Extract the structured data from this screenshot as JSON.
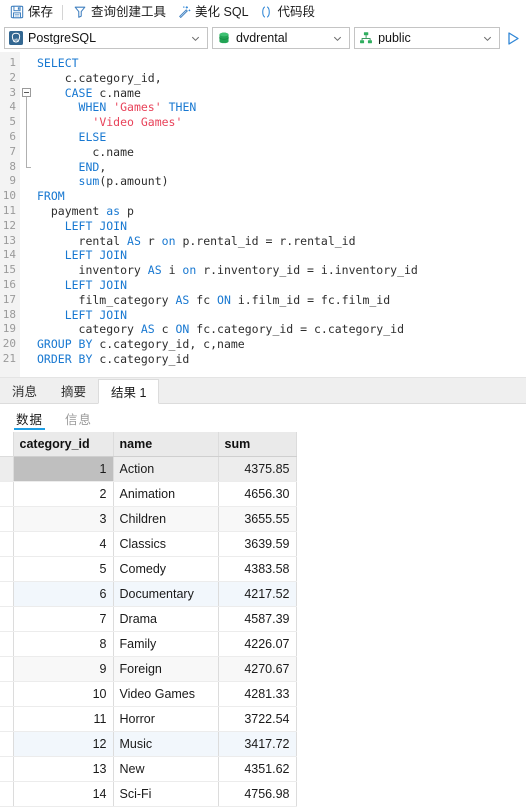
{
  "toolbar": {
    "items": [
      {
        "label": "保存",
        "icon": "save-icon",
        "name": "save"
      },
      {
        "label": "查询创建工具",
        "icon": "query-builder-icon",
        "name": "query-builder"
      },
      {
        "label": "美化 SQL",
        "icon": "beautify-icon",
        "name": "beautify-sql"
      },
      {
        "label": "代码段",
        "icon": "snippet-icon",
        "name": "snippet"
      }
    ]
  },
  "connection": {
    "driver": {
      "label": "PostgreSQL",
      "icon": "postgresql-icon"
    },
    "database": {
      "label": "dvdrental",
      "icon": "database-icon"
    },
    "schema": {
      "label": "public",
      "icon": "schema-icon"
    },
    "run": {
      "icon": "run-icon",
      "label": ""
    }
  },
  "editor": {
    "lines": [
      {
        "n": "1",
        "tokens": [
          {
            "t": "SELECT",
            "c": "kw"
          }
        ]
      },
      {
        "n": "2",
        "tokens": [
          {
            "t": "    c.category_id,",
            "c": "id"
          }
        ]
      },
      {
        "n": "3",
        "fold": "start",
        "tokens": [
          {
            "t": "    ",
            "c": "id"
          },
          {
            "t": "CASE",
            "c": "kw"
          },
          {
            "t": " c.name",
            "c": "id"
          }
        ]
      },
      {
        "n": "4",
        "fold": "cont",
        "tokens": [
          {
            "t": "      ",
            "c": "id"
          },
          {
            "t": "WHEN",
            "c": "kw"
          },
          {
            "t": " ",
            "c": "id"
          },
          {
            "t": "'Games'",
            "c": "str"
          },
          {
            "t": " ",
            "c": "id"
          },
          {
            "t": "THEN",
            "c": "kw"
          }
        ]
      },
      {
        "n": "5",
        "fold": "cont",
        "tokens": [
          {
            "t": "        ",
            "c": "id"
          },
          {
            "t": "'Video Games'",
            "c": "str"
          }
        ]
      },
      {
        "n": "6",
        "fold": "cont",
        "tokens": [
          {
            "t": "      ",
            "c": "id"
          },
          {
            "t": "ELSE",
            "c": "kw"
          }
        ]
      },
      {
        "n": "7",
        "fold": "cont",
        "tokens": [
          {
            "t": "        c.name",
            "c": "id"
          }
        ]
      },
      {
        "n": "8",
        "fold": "end",
        "tokens": [
          {
            "t": "      ",
            "c": "id"
          },
          {
            "t": "END",
            "c": "kw"
          },
          {
            "t": ",",
            "c": "id"
          }
        ]
      },
      {
        "n": "9",
        "tokens": [
          {
            "t": "      ",
            "c": "id"
          },
          {
            "t": "sum",
            "c": "fn"
          },
          {
            "t": "(p.amount)",
            "c": "id"
          }
        ]
      },
      {
        "n": "10",
        "tokens": [
          {
            "t": "FROM",
            "c": "kw"
          }
        ]
      },
      {
        "n": "11",
        "tokens": [
          {
            "t": "  payment ",
            "c": "id"
          },
          {
            "t": "as",
            "c": "kw"
          },
          {
            "t": " p",
            "c": "id"
          }
        ]
      },
      {
        "n": "12",
        "tokens": [
          {
            "t": "    ",
            "c": "id"
          },
          {
            "t": "LEFT JOIN",
            "c": "kw"
          }
        ]
      },
      {
        "n": "13",
        "tokens": [
          {
            "t": "      rental ",
            "c": "id"
          },
          {
            "t": "AS",
            "c": "kw"
          },
          {
            "t": " r ",
            "c": "id"
          },
          {
            "t": "on",
            "c": "kw"
          },
          {
            "t": " p.rental_id = r.rental_id",
            "c": "id"
          }
        ]
      },
      {
        "n": "14",
        "tokens": [
          {
            "t": "    ",
            "c": "id"
          },
          {
            "t": "LEFT JOIN",
            "c": "kw"
          }
        ]
      },
      {
        "n": "15",
        "tokens": [
          {
            "t": "      inventory ",
            "c": "id"
          },
          {
            "t": "AS",
            "c": "kw"
          },
          {
            "t": " i ",
            "c": "id"
          },
          {
            "t": "on",
            "c": "kw"
          },
          {
            "t": " r.inventory_id = i.inventory_id",
            "c": "id"
          }
        ]
      },
      {
        "n": "16",
        "tokens": [
          {
            "t": "    ",
            "c": "id"
          },
          {
            "t": "LEFT JOIN",
            "c": "kw"
          }
        ]
      },
      {
        "n": "17",
        "tokens": [
          {
            "t": "      film_category ",
            "c": "id"
          },
          {
            "t": "AS",
            "c": "kw"
          },
          {
            "t": " fc ",
            "c": "id"
          },
          {
            "t": "ON",
            "c": "kw"
          },
          {
            "t": " i.film_id = fc.film_id",
            "c": "id"
          }
        ]
      },
      {
        "n": "18",
        "tokens": [
          {
            "t": "    ",
            "c": "id"
          },
          {
            "t": "LEFT JOIN",
            "c": "kw"
          }
        ]
      },
      {
        "n": "19",
        "tokens": [
          {
            "t": "      category ",
            "c": "id"
          },
          {
            "t": "AS",
            "c": "kw"
          },
          {
            "t": " c ",
            "c": "id"
          },
          {
            "t": "ON",
            "c": "kw"
          },
          {
            "t": " fc.category_id = c.category_id",
            "c": "id"
          }
        ]
      },
      {
        "n": "20",
        "tokens": [
          {
            "t": "GROUP BY",
            "c": "kw"
          },
          {
            "t": " c.category_id, c,name",
            "c": "id"
          }
        ]
      },
      {
        "n": "21",
        "tokens": [
          {
            "t": "ORDER BY",
            "c": "kw"
          },
          {
            "t": " c.category_id",
            "c": "id"
          }
        ]
      }
    ]
  },
  "result_tabs": [
    {
      "label": "消息",
      "active": false
    },
    {
      "label": "摘要",
      "active": false
    },
    {
      "label": "结果 1",
      "active": true
    }
  ],
  "sub_tabs": [
    {
      "label": "数据",
      "active": true
    },
    {
      "label": "信息",
      "active": false
    }
  ],
  "grid": {
    "columns": [
      "category_id",
      "name",
      "sum"
    ],
    "rows": [
      {
        "category_id": "1",
        "name": "Action",
        "sum": "4375.85",
        "state": "selected"
      },
      {
        "category_id": "2",
        "name": "Animation",
        "sum": "4656.30",
        "state": "normal"
      },
      {
        "category_id": "3",
        "name": "Children",
        "sum": "3655.55",
        "state": "alt"
      },
      {
        "category_id": "4",
        "name": "Classics",
        "sum": "3639.59",
        "state": "normal"
      },
      {
        "category_id": "5",
        "name": "Comedy",
        "sum": "4383.58",
        "state": "normal"
      },
      {
        "category_id": "6",
        "name": "Documentary",
        "sum": "4217.52",
        "state": "blue"
      },
      {
        "category_id": "7",
        "name": "Drama",
        "sum": "4587.39",
        "state": "normal"
      },
      {
        "category_id": "8",
        "name": "Family",
        "sum": "4226.07",
        "state": "normal"
      },
      {
        "category_id": "9",
        "name": "Foreign",
        "sum": "4270.67",
        "state": "alt"
      },
      {
        "category_id": "10",
        "name": "Video Games",
        "sum": "4281.33",
        "state": "normal"
      },
      {
        "category_id": "11",
        "name": "Horror",
        "sum": "3722.54",
        "state": "normal"
      },
      {
        "category_id": "12",
        "name": "Music",
        "sum": "3417.72",
        "state": "blue"
      },
      {
        "category_id": "13",
        "name": "New",
        "sum": "4351.62",
        "state": "normal"
      },
      {
        "category_id": "14",
        "name": "Sci-Fi",
        "sum": "4756.98",
        "state": "normal"
      }
    ]
  },
  "colors": {
    "keyword": "#1878d1",
    "string": "#e8435a",
    "accent": "#1e9de3",
    "selection": "#bfbfbf"
  }
}
